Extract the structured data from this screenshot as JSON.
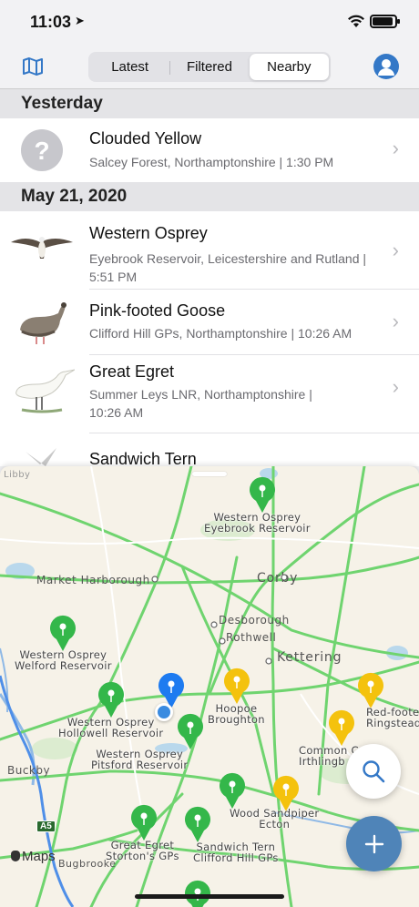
{
  "status_bar": {
    "time": "11:03"
  },
  "segments": [
    {
      "label": "Latest",
      "active": false
    },
    {
      "label": "Filtered",
      "active": false
    },
    {
      "label": "Nearby",
      "active": true
    }
  ],
  "list": {
    "section_yesterday": "Yesterday",
    "section_may21": "May 21, 2020",
    "rows": [
      {
        "title": "Clouded Yellow",
        "subtitle": "Salcey Forest, Northamptonshire  |  1:30 PM"
      },
      {
        "title": "Western Osprey",
        "subtitle": "Eyebrook Reservoir, Leicestershire and Rutland  |  5:51 PM"
      },
      {
        "title": "Pink-footed Goose",
        "subtitle": "Clifford Hill GPs, Northamptonshire  |  10:26 AM"
      },
      {
        "title": "Great Egret",
        "subtitle": "Summer Leys LNR, Northamptonshire  |  10:26 AM"
      },
      {
        "title": "Sandwich Tern",
        "subtitle": ""
      }
    ]
  },
  "map": {
    "pin_labels": [
      "Western Osprey\nEyebrook Reservoir",
      "Western Osprey\nWelford Reservoir",
      "Western Osprey\nHollowell Reservoir",
      "Western Osprey\nPitsford Reservoir",
      "Hoopoe\nBroughton",
      "Red-foote\nRingstead",
      "Common C\nIrthlingb",
      "Wood Sandpiper\nEcton",
      "Sandwich Tern\nClifford Hill GPs",
      "Great Egret\nStorton's GPs"
    ],
    "places": [
      "Market Harborough",
      "Desborough",
      "Rothwell",
      "Buckby",
      "Bugbrooke",
      "Libby"
    ],
    "towns": [
      "Corby",
      "Kettering"
    ],
    "road": "A5",
    "attribution": "Maps",
    "colors": {
      "green": "#34b74a",
      "yellow": "#f4c20d",
      "blue": "#1e7bf0",
      "fab": "#4f84b8"
    }
  }
}
